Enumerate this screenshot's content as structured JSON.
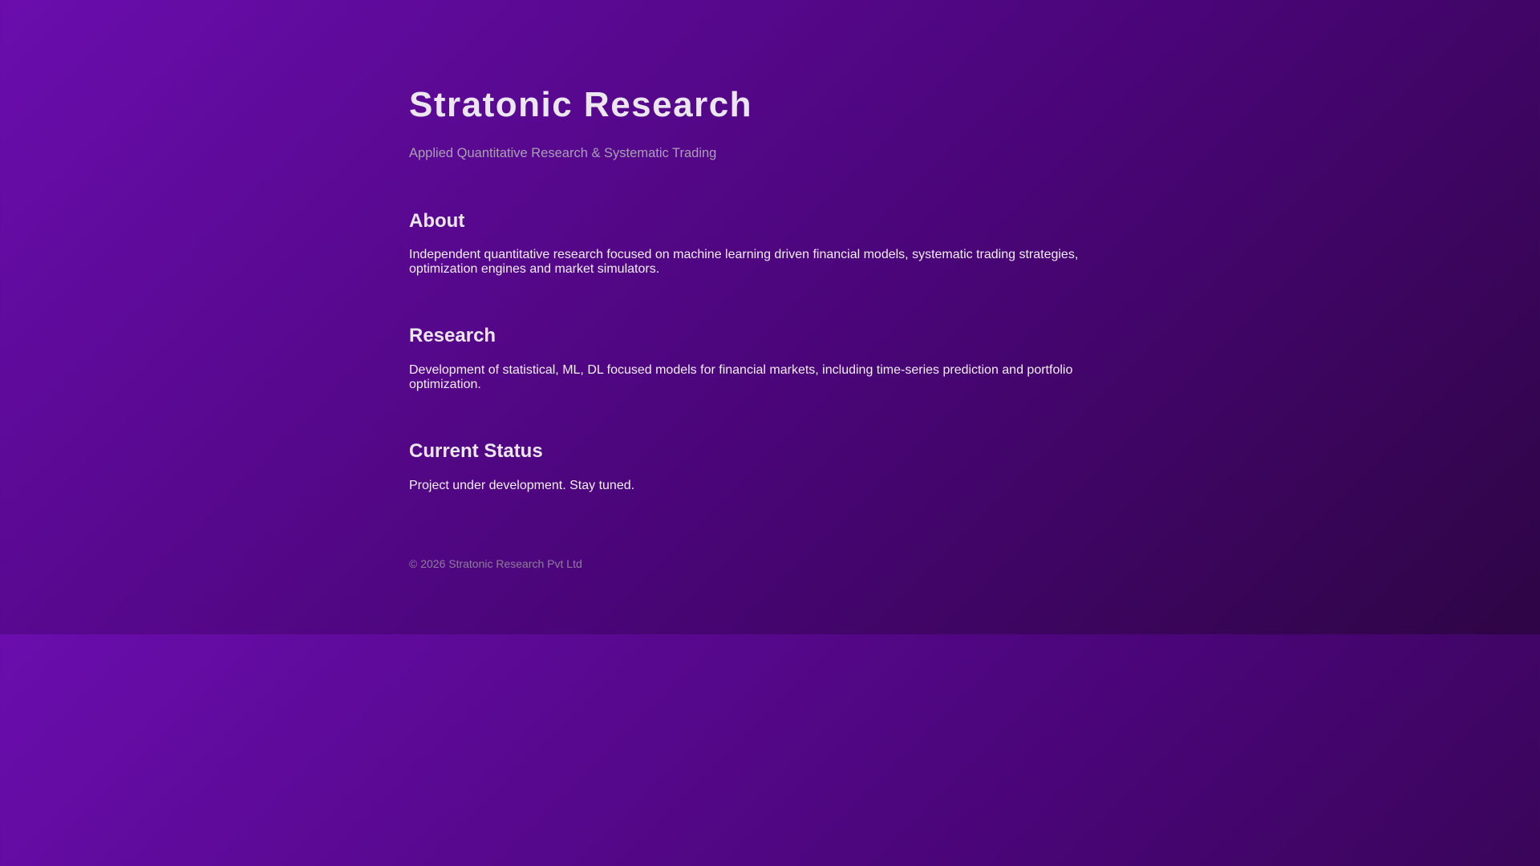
{
  "header": {
    "title": "Stratonic Research",
    "subtitle": "Applied Quantitative Research & Systematic Trading"
  },
  "sections": [
    {
      "heading": "About",
      "text": "Independent quantitative research focused on machine learning driven financial models, systematic trading strategies, optimization engines and market simulators."
    },
    {
      "heading": "Research",
      "text": "Development of statistical, ML, DL focused models for financial markets, including time-series prediction and portfolio optimization."
    },
    {
      "heading": "Current Status",
      "text": "Project under development. Stay tuned."
    }
  ],
  "footer": {
    "copyright": "© 2026 Stratonic Research Pvt Ltd"
  },
  "colors": {
    "gradient_start": "#6a0dad",
    "gradient_end": "#2e0545"
  }
}
